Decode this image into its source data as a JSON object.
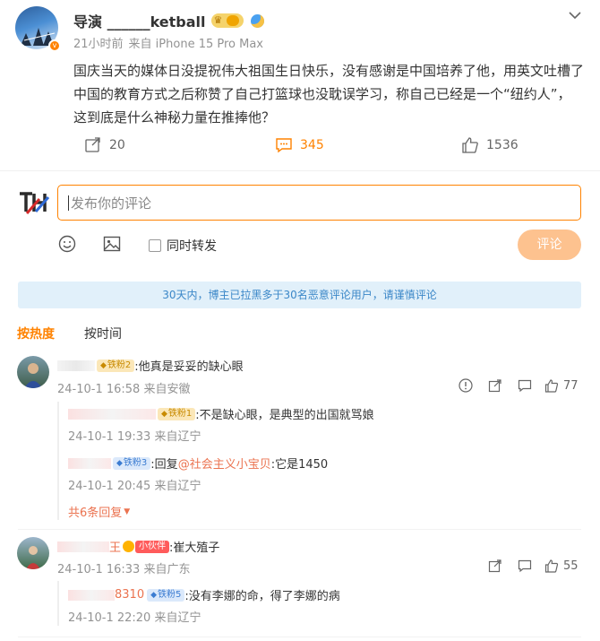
{
  "post": {
    "author_name": "导演 ______ketball",
    "timestamp": "21小时前",
    "source": "来自 iPhone 15 Pro Max",
    "content": "国庆当天的媒体日没提祝伟大祖国生日快乐，没有感谢是中国培养了他，用英文吐槽了中国的教育方式之后称赞了自己打篮球也没耽误学习，称自己已经是一个“纽约人”，这到底是什么神秘力量在推捧他？",
    "actions": {
      "repost_count": "20",
      "comment_count": "345",
      "like_count": "1536"
    }
  },
  "compose": {
    "placeholder": "发布你的评论",
    "forward_label": "同时转发",
    "submit_label": "评论"
  },
  "notice": "30天内，博主已拉黑多于30名恶意评论用户，请谨慎评论",
  "sort_tabs": [
    "按热度",
    "按时间"
  ],
  "comments": [
    {
      "text": ":他真是妥妥的缺心眼",
      "badge": "铁粉2",
      "time": "24-10-1 16:58 来自安徽",
      "likes": "77",
      "replies": [
        {
          "badge": "铁粉1",
          "text": ":不是缺心眼，是典型的出国就骂娘",
          "time": "24-10-1 19:33 来自辽宁"
        },
        {
          "badge": "铁粉3",
          "prefix": ":回复",
          "mention": "@社会主义小宝贝",
          "suffix": ":它是1450",
          "time": "24-10-1 20:45 来自辽宁"
        }
      ],
      "more_replies": "共6条回复"
    },
    {
      "name_suffix": "王",
      "badge": "小伙伴",
      "text": ":崔大殖子",
      "time": "24-10-1 16:33 来自广东",
      "likes": "55",
      "replies": [
        {
          "name_part": "8310",
          "badge": "铁粉5",
          "text": ":没有李娜的命，得了李娜的病",
          "time": "24-10-1 22:20 来自辽宁"
        }
      ]
    }
  ],
  "colors": {
    "accent": "#ff8200",
    "link": "#eb7350",
    "muted": "#939393",
    "notice_bg": "#e1f0fa",
    "notice_text": "#3b87c8",
    "submit_bg": "#fdc28f"
  }
}
